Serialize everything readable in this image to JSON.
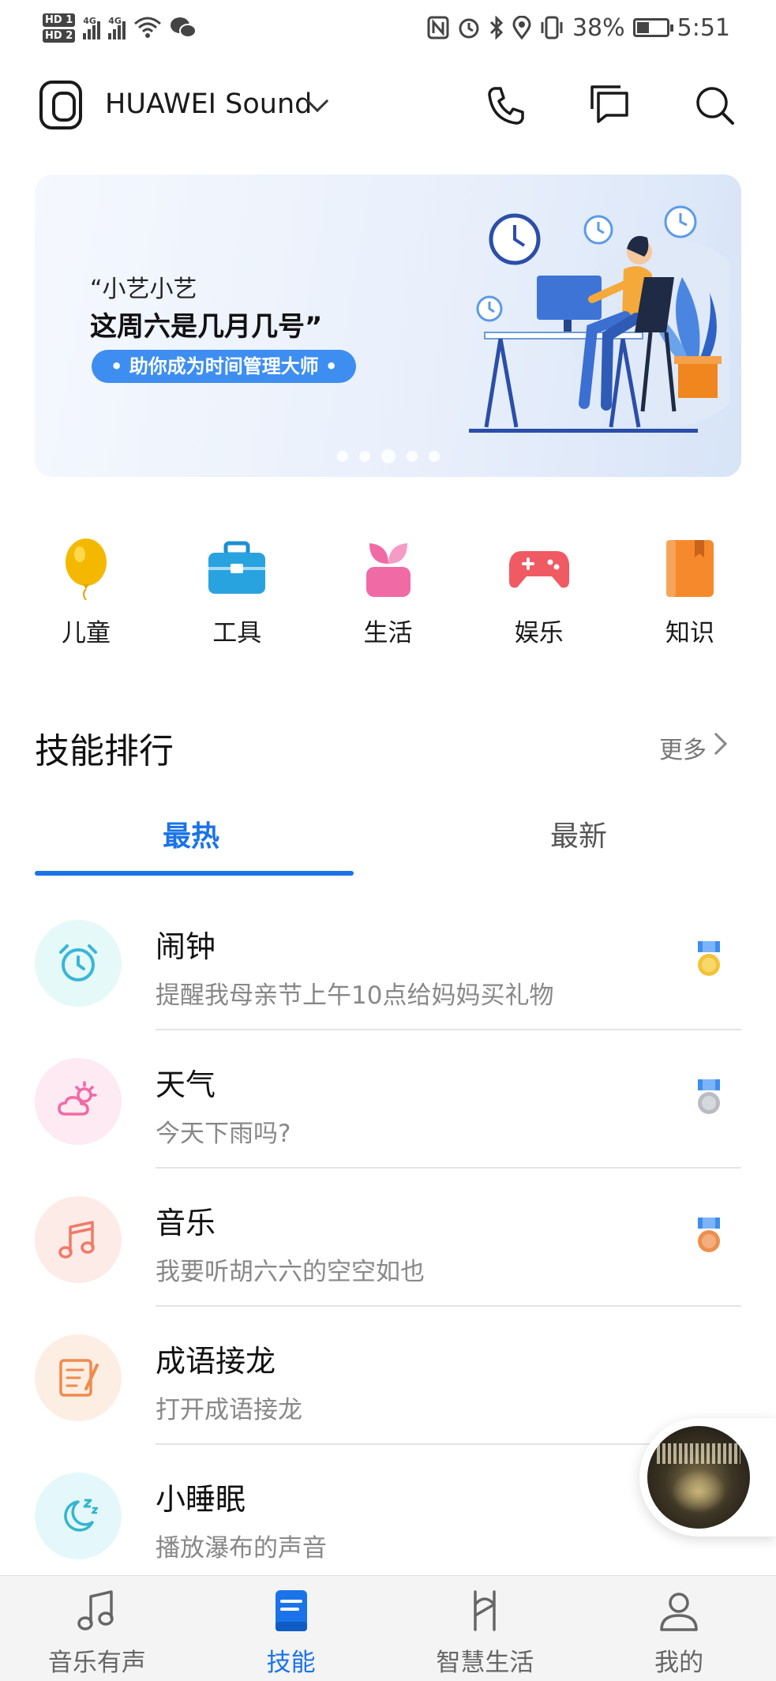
{
  "status_bar": {
    "hd1": "HD 1",
    "hd2": "HD 2",
    "net1": "4G",
    "net2": "4G",
    "battery": "38%",
    "time": "5:51",
    "icons": [
      "nfc-icon",
      "alarm-icon",
      "bluetooth-icon",
      "location-icon",
      "vibrate-icon",
      "battery-icon"
    ]
  },
  "header": {
    "device_name": "HUAWEI Sound",
    "icons": [
      "phone-icon",
      "message-icon",
      "search-icon"
    ]
  },
  "banner": {
    "line1": "“小艺小艺",
    "line2": "这周六是几月几号”",
    "pill": "• 助你成为时间管理大师 •",
    "page_count": 5,
    "active_index": 2
  },
  "categories": [
    {
      "label": "儿童",
      "icon": "balloon-icon",
      "color": "#f5b800"
    },
    {
      "label": "工具",
      "icon": "toolbox-icon",
      "color": "#29a3e0"
    },
    {
      "label": "生活",
      "icon": "plant-icon",
      "color": "#f06aa5"
    },
    {
      "label": "娱乐",
      "icon": "gamepad-icon",
      "color": "#f05a63"
    },
    {
      "label": "知识",
      "icon": "book-icon",
      "color": "#f5892b"
    }
  ],
  "ranking": {
    "title": "技能排行",
    "more": "更多",
    "tabs": [
      {
        "label": "最热",
        "active": true
      },
      {
        "label": "最新",
        "active": false
      }
    ],
    "items": [
      {
        "title": "闹钟",
        "subtitle": "提醒我母亲节上午10点给妈妈买礼物",
        "icon": "alarm-clock-icon",
        "bg": "#e6f9f9",
        "medal": "gold"
      },
      {
        "title": "天气",
        "subtitle": "今天下雨吗?",
        "icon": "weather-icon",
        "bg": "#fdeaf2",
        "medal": "silver"
      },
      {
        "title": "音乐",
        "subtitle": "我要听胡六六的空空如也",
        "icon": "music-note-icon",
        "bg": "#fdebe8",
        "medal": "bronze"
      },
      {
        "title": "成语接龙",
        "subtitle": "打开成语接龙",
        "icon": "idiom-icon",
        "bg": "#fdeee4",
        "medal": ""
      },
      {
        "title": "小睡眠",
        "subtitle": "播放瀑布的声音",
        "icon": "sleep-moon-icon",
        "bg": "#e4f8fb",
        "medal": ""
      }
    ]
  },
  "bottom_nav": [
    {
      "label": "音乐有声",
      "icon": "music-icon",
      "active": false
    },
    {
      "label": "技能",
      "icon": "skills-book-icon",
      "active": true
    },
    {
      "label": "智慧生活",
      "icon": "smart-life-icon",
      "active": false
    },
    {
      "label": "我的",
      "icon": "profile-icon",
      "active": false
    }
  ],
  "colors": {
    "accent": "#1a73e8",
    "banner_pill": "#3d8ef0"
  }
}
